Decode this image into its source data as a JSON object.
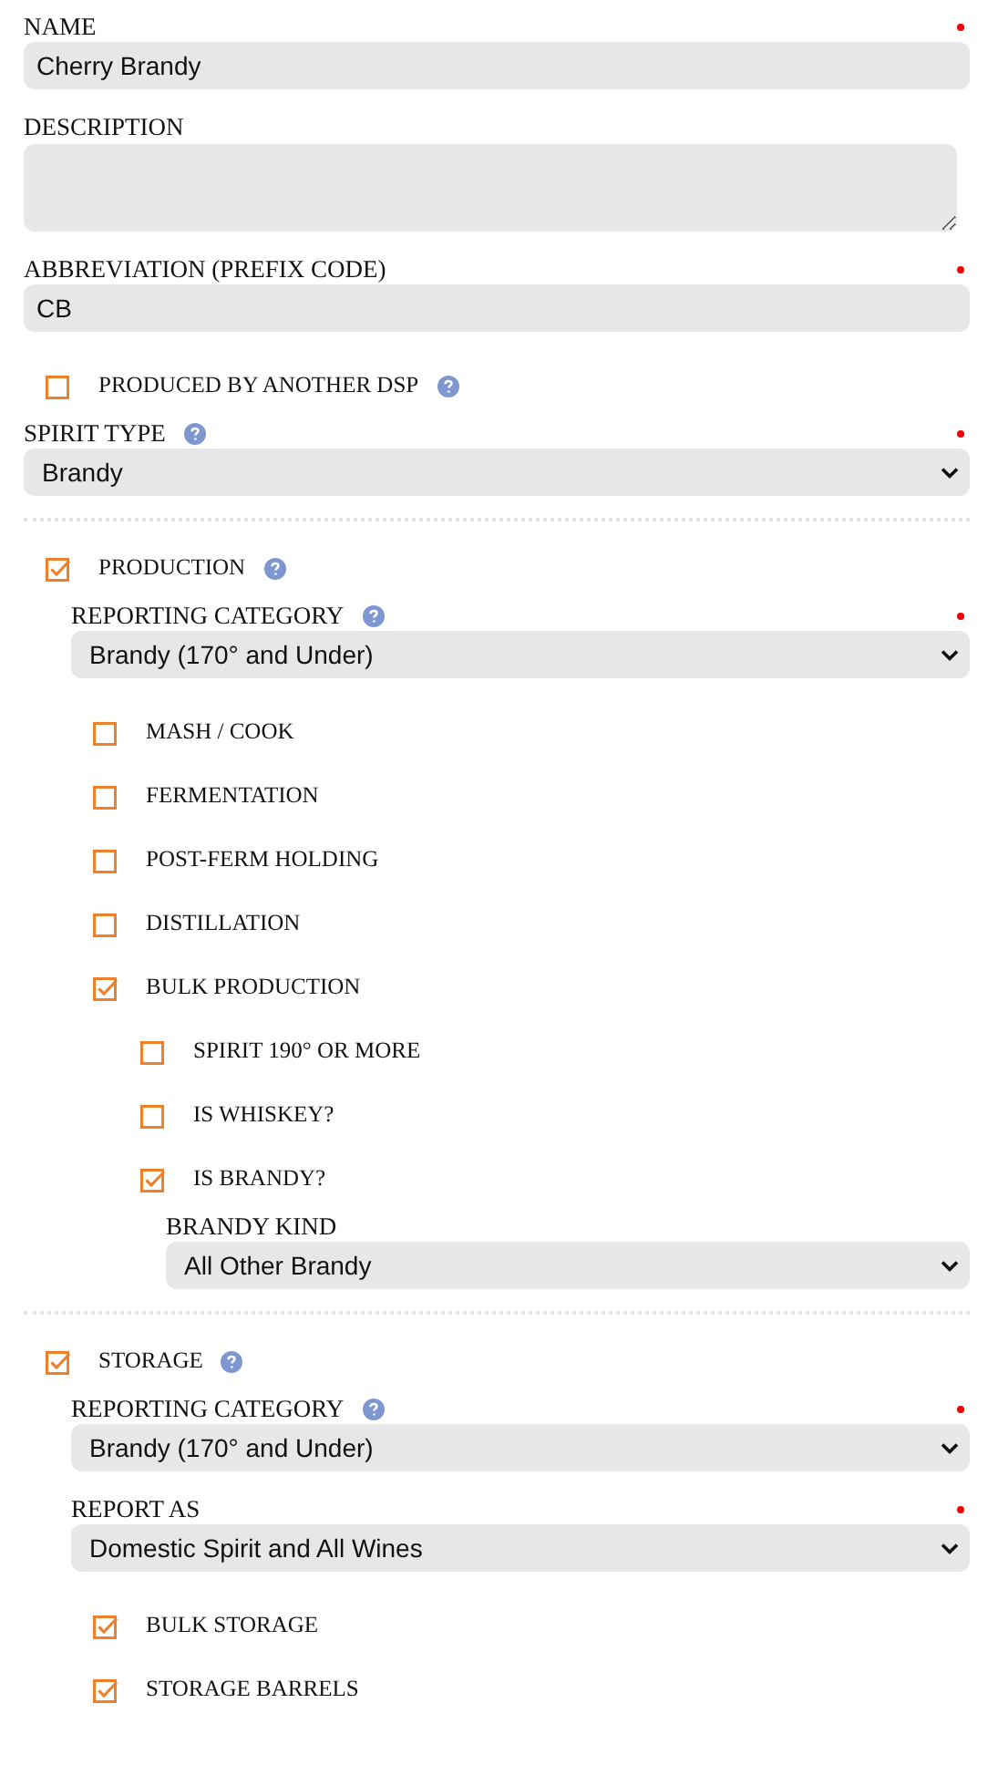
{
  "fields": [
    {
      "kind": "text",
      "label": "NAME",
      "required": true,
      "value": "Cherry Brandy"
    },
    {
      "kind": "textarea",
      "label": "DESCRIPTION",
      "required": false
    },
    {
      "kind": "text",
      "label": "ABBREVIATION (PREFIX CODE)",
      "required": true,
      "value": "CB"
    },
    {
      "kind": "checkbox",
      "label": "PRODUCED BY ANOTHER DSP",
      "checked": false,
      "help": true
    },
    {
      "kind": "select",
      "label": "SPIRIT TYPE",
      "help": true,
      "required": true,
      "value": "Brandy"
    },
    {
      "kind": "section",
      "label": "PRODUCTION",
      "checked": true,
      "help": true,
      "children": [
        {
          "kind": "select",
          "label": "REPORTING CATEGORY",
          "help": true,
          "required": true,
          "value": "Brandy (170° and Under)"
        },
        {
          "kind": "checkbox",
          "label": "MASH / COOK",
          "checked": false
        },
        {
          "kind": "checkbox",
          "label": "FERMENTATION",
          "checked": false
        },
        {
          "kind": "checkbox",
          "label": "POST-FERM HOLDING",
          "checked": false
        },
        {
          "kind": "checkbox",
          "label": "DISTILLATION",
          "checked": false
        },
        {
          "kind": "checkbox",
          "label": "BULK PRODUCTION",
          "checked": true,
          "children": [
            {
              "kind": "checkbox",
              "label": "SPIRIT 190° OR MORE",
              "checked": false
            },
            {
              "kind": "checkbox",
              "label": "IS WHISKEY?",
              "checked": false
            },
            {
              "kind": "checkbox",
              "label": "IS BRANDY?",
              "checked": true,
              "children": [
                {
                  "kind": "select",
                  "label": "BRANDY KIND",
                  "required": false,
                  "value": "All Other Brandy"
                }
              ]
            }
          ]
        }
      ]
    },
    {
      "kind": "section",
      "label": "STORAGE",
      "checked": true,
      "help": true,
      "children": [
        {
          "kind": "select",
          "label": "REPORTING CATEGORY",
          "help": true,
          "required": true,
          "value": "Brandy (170° and Under)"
        },
        {
          "kind": "select",
          "label": "REPORT AS",
          "required": true,
          "value": "Domestic Spirit and All Wines"
        },
        {
          "kind": "checkbox",
          "label": "BULK STORAGE",
          "checked": true
        },
        {
          "kind": "checkbox",
          "label": "STORAGE BARRELS",
          "checked": true
        }
      ]
    }
  ]
}
